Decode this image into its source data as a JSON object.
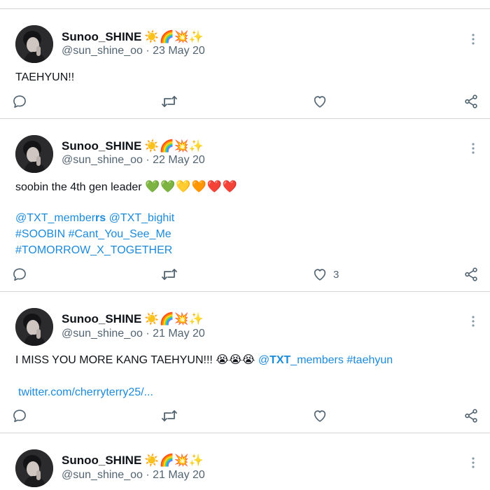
{
  "colors": {
    "link": "#1d8ad8",
    "secondary_text": "#536471",
    "divider": "#d4d4d4"
  },
  "icons": {
    "reply": "speech-bubble-icon",
    "retweet": "retweet-arrows-icon",
    "like": "heart-outline-icon",
    "share": "share-nodes-icon",
    "more": "vertical-ellipsis-icon"
  },
  "tweets": [
    {
      "display_name": "Sunoo_SHINE",
      "name_emojis": "☀️🌈💥✨",
      "handle_date": "@sun_shine_oo · 23 May 20",
      "text": "TAEHYUN!!",
      "like_count": ""
    },
    {
      "display_name": "Sunoo_SHINE",
      "name_emojis": "☀️🌈💥✨",
      "handle_date": "@sun_shine_oo · 22 May 20",
      "text": "soobin the 4th gen leader",
      "text_hearts": "💚💚💛🧡❤️❤️",
      "mention_1_a": "@TXT_member",
      "mention_1_b": "rs",
      "mention_2": "@TXT_bighit",
      "hashtag_1": "#SOOBIN",
      "hashtag_2": "#Cant_You_See_Me",
      "hashtag_3": "#TOMORROW_X_TOGETHER",
      "like_count": "3"
    },
    {
      "display_name": "Sunoo_SHINE",
      "name_emojis": "☀️🌈💥✨",
      "handle_date": "@sun_shine_oo · 21 May 20",
      "text": "I MISS YOU MORE KANG TAEHYUN!!!",
      "text_emojis": "😭😭😭",
      "mention_a": "@",
      "mention_b": "TXT",
      "mention_c": "_members",
      "hashtag": "#taehyun",
      "url": "twitter.com/cherryterry25/...",
      "like_count": ""
    },
    {
      "display_name": "Sunoo_SHINE",
      "name_emojis": "☀️🌈💥✨",
      "handle_date": "@sun_shine_oo · 21 May 20"
    }
  ]
}
